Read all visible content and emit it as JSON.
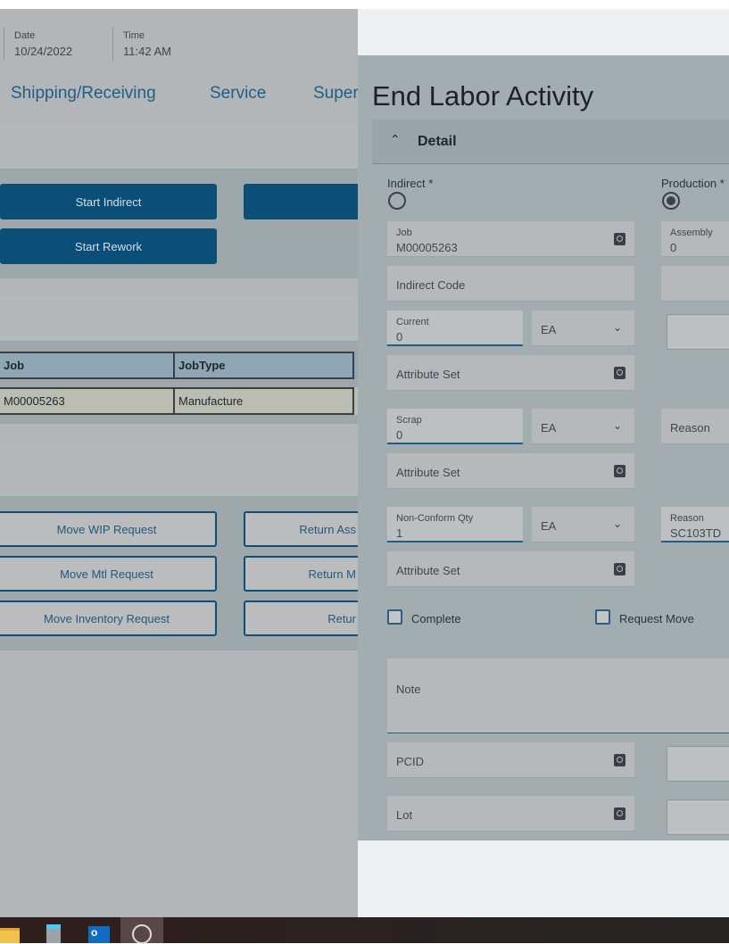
{
  "header": {
    "date_label": "Date",
    "date_value": "10/24/2022",
    "time_label": "Time",
    "time_value": "11:42 AM"
  },
  "nav_tabs": [
    "Shipping/Receiving",
    "Service",
    "Super"
  ],
  "actions": {
    "start_indirect": "Start Indirect",
    "start_rework": "Start Rework"
  },
  "table": {
    "columns": [
      "Job",
      "JobType"
    ],
    "rows": [
      [
        "M00005263",
        "Manufacture"
      ]
    ]
  },
  "requests": {
    "move_wip": "Move WIP Request",
    "move_mtl": "Move Mtl Request",
    "move_inventory": "Move Inventory Request",
    "return_asm": "Return Ass",
    "return_m": "Return M",
    "return": "Retur"
  },
  "dialog": {
    "title": "End Labor Activity",
    "section": "Detail",
    "indirect_label": "Indirect *",
    "production_label": "Production *",
    "job_label": "Job",
    "job_value": "M00005263",
    "assembly_label": "Assembly",
    "assembly_value": "0",
    "indirect_code": "Indirect Code",
    "current_label": "Current",
    "current_value": "0",
    "current_uom": "EA",
    "attribute_set": "Attribute Set",
    "scrap_label": "Scrap",
    "scrap_value": "0",
    "scrap_uom": "EA",
    "reason_label": "Reason",
    "nonconform_label": "Non-Conform Qty",
    "nonconform_value": "1",
    "nonconform_uom": "EA",
    "reason2_label": "Reason",
    "reason2_value": "SC103TD",
    "complete_label": "Complete",
    "request_move_label": "Request Move",
    "note_label": "Note",
    "pcid_label": "PCID",
    "lot_label": "Lot"
  },
  "taskbar": {
    "icons": [
      "file-explorer",
      "calculator",
      "outlook",
      "clock"
    ]
  }
}
